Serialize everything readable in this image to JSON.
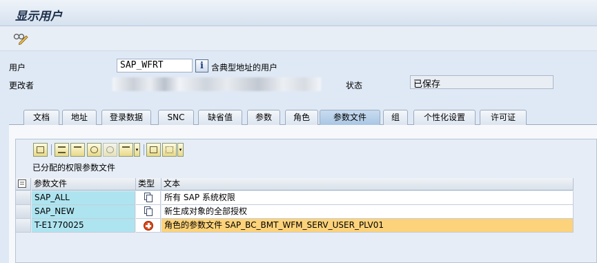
{
  "window": {
    "title": "显示用户"
  },
  "toolbar": {
    "glasses_icon": "display-change-icon"
  },
  "form": {
    "user_label": "用户",
    "user_value": "SAP_WFRT",
    "user_note": "含典型地址的用户",
    "changed_by_label": "更改者",
    "status_label": "状态",
    "status_value": "已保存"
  },
  "tabs": [
    {
      "label": "文档"
    },
    {
      "label": "地址"
    },
    {
      "label": "登录数据"
    },
    {
      "label": "SNC"
    },
    {
      "label": "缺省值"
    },
    {
      "label": "参数"
    },
    {
      "label": "角色"
    },
    {
      "label": "参数文件"
    },
    {
      "label": "组"
    },
    {
      "label": "个性化设置"
    },
    {
      "label": "许可证"
    }
  ],
  "active_tab": "参数文件",
  "table": {
    "title": "已分配的权限参数文件",
    "columns": {
      "selector": "",
      "profile": "参数文件",
      "type": "类型",
      "text": "文本"
    },
    "rows": [
      {
        "profile": "SAP_ALL",
        "type_icon": "document-icon",
        "text": "所有 SAP 系统权限"
      },
      {
        "profile": "SAP_NEW",
        "type_icon": "document-icon",
        "text": "新生成对象的全部授权"
      },
      {
        "profile": "T-E1770025",
        "type_icon": "role-icon",
        "text": "角色的参数文件 SAP_BC_BMT_WFM_SERV_USER_PLV01"
      }
    ]
  },
  "colors": {
    "key_cell": "#aee4f0",
    "highlight_row": "#fcd27a",
    "role_icon": "#e24a1c"
  }
}
